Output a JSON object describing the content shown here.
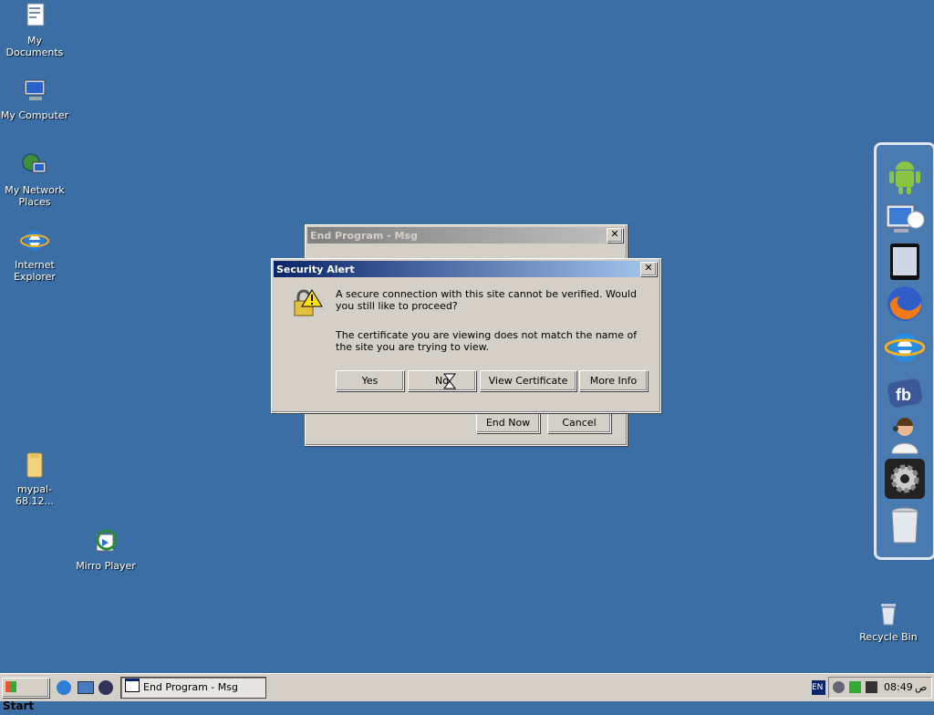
{
  "desktop": {
    "icons": [
      {
        "label": "My Documents"
      },
      {
        "label": "My Computer"
      },
      {
        "label": "My Network Places"
      },
      {
        "label": "Internet Explorer"
      },
      {
        "label": "mypal-68.12..."
      },
      {
        "label": "Mirro Player"
      },
      {
        "label": "Recycle Bin"
      }
    ]
  },
  "end_program_dialog": {
    "title": "End Program - Msg",
    "end_now": "End Now",
    "cancel": "Cancel"
  },
  "security_alert": {
    "title": "Security Alert",
    "message1": "A secure connection with this site cannot be verified. Would you still like to proceed?",
    "message2": "The certificate you are viewing does not match the name of the site you are trying to view.",
    "yes": "Yes",
    "no": "No",
    "view_certificate": "View Certificate",
    "more_info": "More Info"
  },
  "dock": {
    "items": [
      "android-icon",
      "remote-desktop-icon",
      "tablet-icon",
      "firefox-icon",
      "internet-explorer-icon",
      "facebook-icon",
      "support-agent-icon",
      "settings-gear-icon",
      "trash-can-icon"
    ]
  },
  "taskbar": {
    "start": "Start",
    "task_label": "End Program - Msg",
    "lang": "EN",
    "clock_time": "08:49",
    "clock_ampm": "ص"
  },
  "colors": {
    "desktop": "#3a6ea5",
    "title_active": "#0a246a",
    "title_inactive": "#808080",
    "face": "#d4d0c8"
  }
}
